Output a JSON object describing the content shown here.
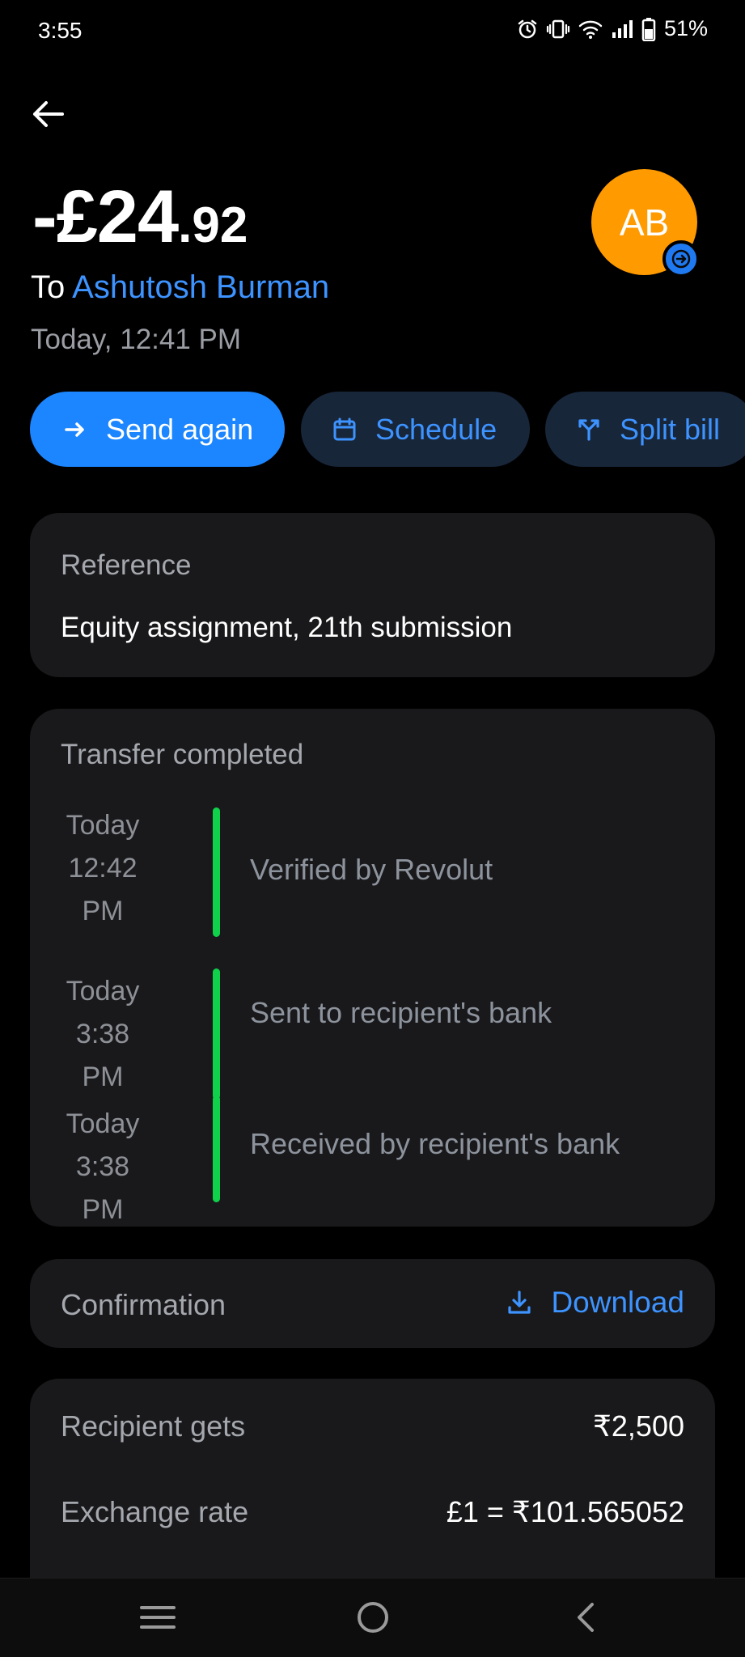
{
  "status_bar": {
    "time": "3:55",
    "battery": "51%",
    "icons": [
      "alarm-icon",
      "vibrate-icon",
      "wifi-icon",
      "signal-icon",
      "battery-icon"
    ]
  },
  "header": {
    "amount_main": "-£24",
    "amount_cents": ".92",
    "to_prefix": "To ",
    "recipient_name": "Ashutosh Burman",
    "datetime": "Today, 12:41 PM",
    "avatar_initials": "AB",
    "avatar_color": "#ff9a00"
  },
  "actions": {
    "send_again": "Send again",
    "schedule": "Schedule",
    "split_bill": "Split bill"
  },
  "reference": {
    "title": "Reference",
    "value": "Equity assignment, 21th submission"
  },
  "transfer": {
    "title": "Transfer completed",
    "steps": [
      {
        "time_line1": "Today",
        "time_line2": "12:42",
        "time_line3": "PM",
        "label": "Verified by Revolut"
      },
      {
        "time_line1": "Today",
        "time_line2": "3:38 PM",
        "label": "Sent to recipient's bank"
      },
      {
        "time_line1": "Today",
        "time_line2": "3:38 PM",
        "label": "Received by recipient's bank"
      }
    ],
    "progress_color": "#0fd14a"
  },
  "confirmation": {
    "title": "Confirmation",
    "download_label": "Download"
  },
  "details": {
    "rows": [
      {
        "label": "Recipient gets",
        "value": "₹2,500"
      },
      {
        "label": "Exchange rate",
        "value": "£1 = ₹101.565052"
      }
    ]
  },
  "colors": {
    "accent": "#1b86ff",
    "link": "#3d93ff",
    "card": "#19191b",
    "background": "#000000"
  }
}
